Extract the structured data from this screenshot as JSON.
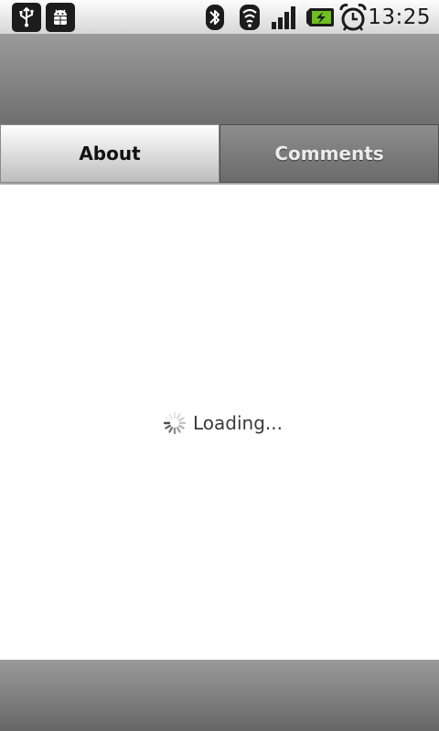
{
  "status_bar": {
    "time": "13:25",
    "notification_icons": [
      "usb-icon",
      "android-debug-icon"
    ],
    "system_icons": [
      "bluetooth-icon",
      "wifi-icon",
      "signal-icon",
      "battery-charging-icon",
      "alarm-clock-icon"
    ]
  },
  "tabs": [
    {
      "label": "About",
      "selected": true
    },
    {
      "label": "Comments",
      "selected": false
    }
  ],
  "content": {
    "loading_text": "Loading..."
  },
  "colors": {
    "title_area": "#8a8a8a",
    "battery_accent": "#6ebf1f",
    "status_bg": "#eaeaea"
  }
}
